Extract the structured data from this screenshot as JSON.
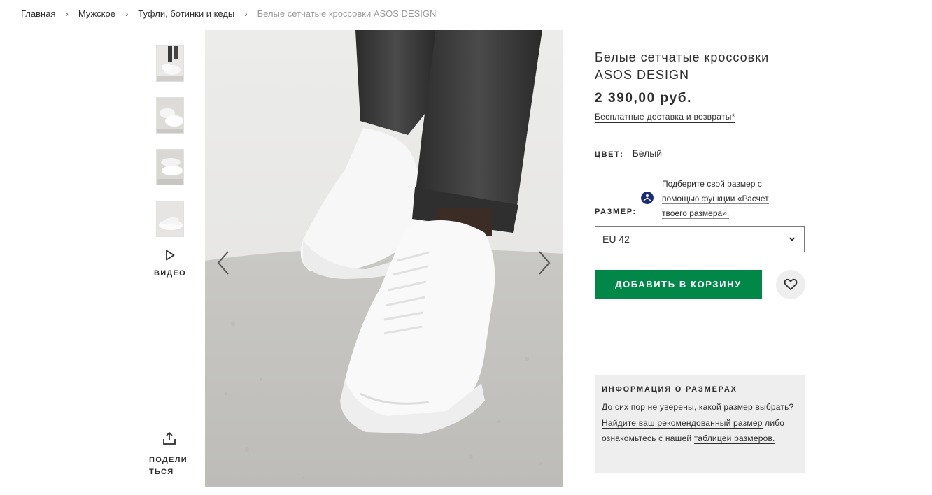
{
  "breadcrumb": [
    {
      "label": "Главная"
    },
    {
      "label": "Мужское"
    },
    {
      "label": "Туфли, ботинки и кеды"
    },
    {
      "label": "Белые сетчатые кроссовки ASOS DESIGN"
    }
  ],
  "breadcrumb_separator": "›",
  "gallery": {
    "thumbnail_count": 4,
    "video_label": "ВИДЕО",
    "share_label": "ПОДЕЛИТЬСЯ",
    "prev_icon": "chevron-left-icon",
    "next_icon": "chevron-right-icon"
  },
  "product": {
    "title_line1": "Белые сетчатые кроссовки",
    "title_line2": "ASOS DESIGN",
    "price": "2 390,00 руб.",
    "delivery_link": "Бесплатные доставка и возвраты*",
    "color_label": "ЦВЕТ:",
    "color_value": "Белый",
    "size_label": "РАЗМЕР:",
    "fit_link": "Подберите свой размер с помощью функции «Расчет твоего размера».",
    "size_selected": "EU 42",
    "add_to_cart": "ДОБАВИТЬ В КОРЗИНУ",
    "wishlist_icon": "heart-icon"
  },
  "size_info": {
    "heading": "ИНФОРМАЦИЯ О РАЗМЕРАХ",
    "text_before": "До сих пор не уверены, какой размер выбрать? ",
    "link1": "Найдите ваш рекомендованный размер",
    "text_middle": " либо ознакомьтесь с нашей ",
    "link2": "таблицей размеров."
  },
  "colors": {
    "accent_green": "#018849",
    "fit_icon_blue": "#1a2a7a",
    "text": "#2d2d2d",
    "panel_bg": "#eeeeee"
  }
}
